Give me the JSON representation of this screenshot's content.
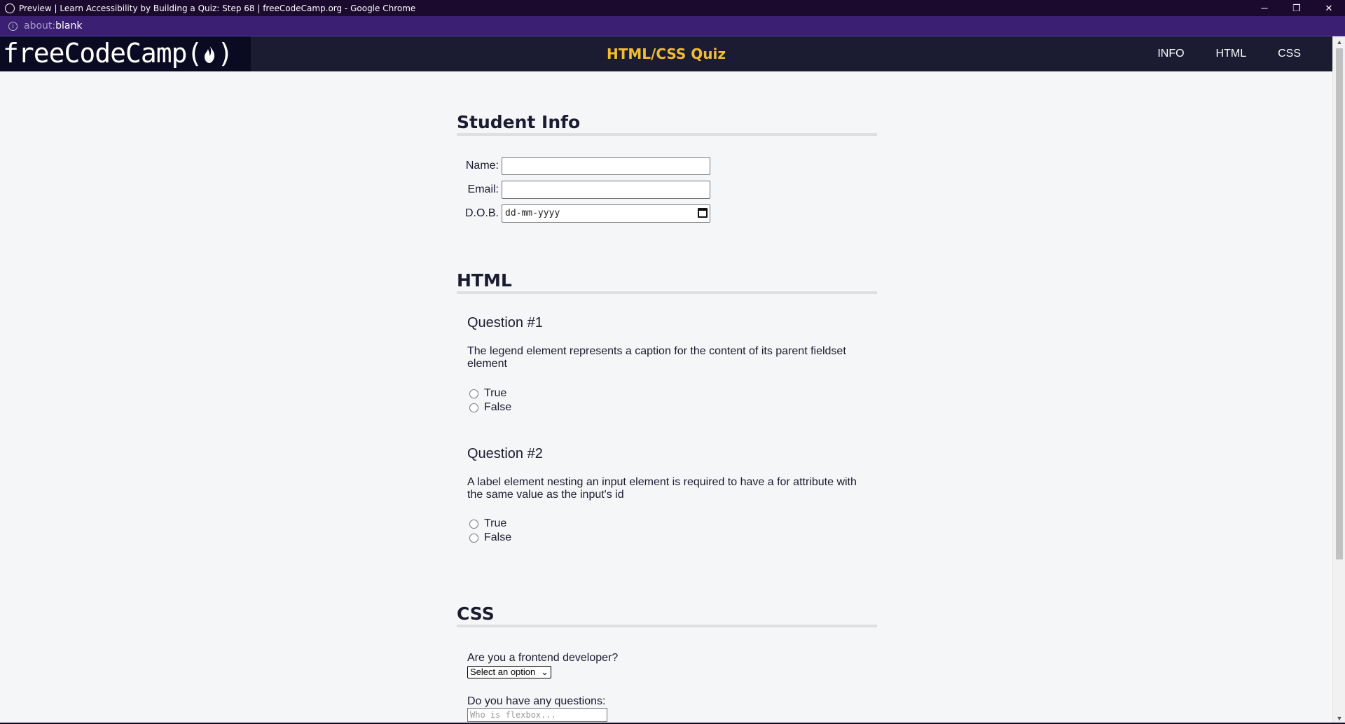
{
  "window": {
    "title": "Preview | Learn Accessibility by Building a Quiz: Step 68 | freeCodeCamp.org - Google Chrome",
    "controls": {
      "minimize": "─",
      "maximize": "❐",
      "close": "✕"
    }
  },
  "address": {
    "scheme": "about:",
    "host": "blank"
  },
  "header": {
    "logo_text": "freeCodeCamp(",
    "logo_close": ")",
    "title": "HTML/CSS Quiz",
    "nav": {
      "info": "INFO",
      "html": "HTML",
      "css": "CSS"
    }
  },
  "student_info": {
    "heading": "Student Info",
    "name_label": "Name:",
    "email_label": "Email:",
    "dob_label": "D.O.B.",
    "dob_placeholder": "dd-mm-yyyy"
  },
  "html_section": {
    "heading": "HTML",
    "questions": [
      {
        "title": "Question #1",
        "text": "The legend element represents a caption for the content of its parent fieldset element",
        "options": [
          "True",
          "False"
        ]
      },
      {
        "title": "Question #2",
        "text": "A label element nesting an input element is required to have a for attribute with the same value as the input's id",
        "options": [
          "True",
          "False"
        ]
      }
    ]
  },
  "css_section": {
    "heading": "CSS",
    "q1": "Are you a frontend developer?",
    "select_value": "Select an option",
    "q2": "Do you have any questions:",
    "textarea_placeholder": "Who is flexbox..."
  }
}
